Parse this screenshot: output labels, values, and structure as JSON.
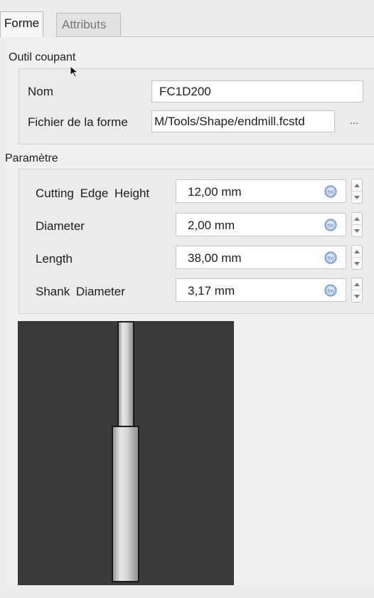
{
  "tabs": [
    {
      "label": "Forme",
      "active": true
    },
    {
      "label": "Attributs",
      "active": false
    }
  ],
  "tool_group": {
    "title": "Outil coupant",
    "name_label": "Nom",
    "name_value": "FC1D200",
    "shape_file_label": "Fichier de la forme",
    "shape_file_value": "M/Tools/Shape/endmill.fcstd",
    "browse_label": "..."
  },
  "params_group": {
    "title": "Paramètre",
    "params": [
      {
        "label": "Cutting Edge Height",
        "value": "12,00 mm"
      },
      {
        "label": "Diameter",
        "value": "2,00 mm"
      },
      {
        "label": "Length",
        "value": "38,00 mm"
      },
      {
        "label": "Shank Diameter",
        "value": "3,17 mm"
      }
    ]
  },
  "preview": {
    "background": "#3a3a3a",
    "tool_color": "#cfcfcf"
  },
  "icons": {
    "expression": "expression-icon",
    "cursor": "mouse-cursor-icon"
  }
}
